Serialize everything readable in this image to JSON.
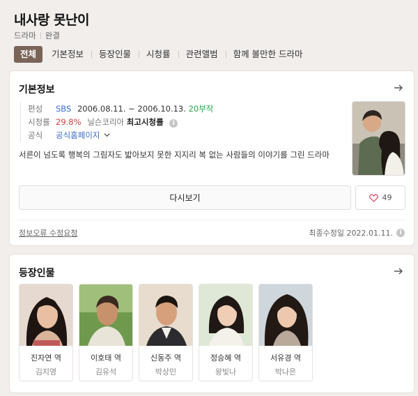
{
  "header": {
    "title": "내사랑 못난이",
    "genre": "드라마",
    "status": "완결",
    "tabs": [
      "전체",
      "기본정보",
      "등장인물",
      "시청률",
      "관련앨범",
      "함께 볼만한 드라마"
    ]
  },
  "basic": {
    "section_title": "기본정보",
    "rows": {
      "broadcast_label": "편성",
      "channel": "SBS",
      "period": "2006.08.11. ~ 2006.10.13.",
      "episodes": "20부작",
      "ratings_label": "시청률",
      "rating": "29.8%",
      "rating_source": "닐슨코리아",
      "rating_type": "최고시청률",
      "official_label": "공식",
      "official_link": "공식홈페이지"
    },
    "description": "서른이 넘도록 행복의 그림자도 밟아보지 못한 지지리 복 없는 사람들의 이야기를 그린 드라마",
    "watch_label": "다시보기",
    "like_count": "49",
    "report_label": "정보오류 수정요청",
    "modified_label": "최종수정일 2022.01.11."
  },
  "cast": {
    "section_title": "등장인물",
    "people": [
      {
        "role": "진자연 역",
        "actor": "김지영"
      },
      {
        "role": "이호태 역",
        "actor": "김유석"
      },
      {
        "role": "신동주 역",
        "actor": "박상민"
      },
      {
        "role": "정승혜 역",
        "actor": "왕빛나"
      },
      {
        "role": "서유경 역",
        "actor": "박나은"
      }
    ]
  },
  "colors": {
    "tab_active": "#7a6458",
    "link_blue": "#3b6cc7",
    "episodes_green": "#2aa54a",
    "rating_red": "#d43c3c",
    "background": "#f1eeec"
  }
}
